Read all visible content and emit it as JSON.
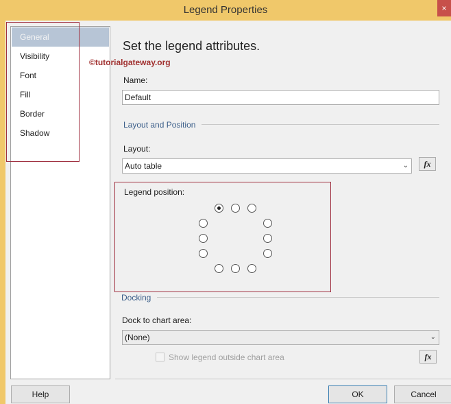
{
  "window": {
    "title": "Legend Properties",
    "close_label": "×"
  },
  "nav": {
    "items": [
      "General",
      "Visibility",
      "Font",
      "Fill",
      "Border",
      "Shadow"
    ],
    "selected": "General"
  },
  "main": {
    "heading": "Set the legend attributes.",
    "watermark": "©tutorialgateway.org",
    "name_label": "Name:",
    "name_value": "Default",
    "layout_section": "Layout and Position",
    "layout_label": "Layout:",
    "layout_value": "Auto table",
    "fx_label": "fx",
    "legend_position_label": "Legend position:",
    "legend_position_selected": "top-left",
    "docking_section": "Docking",
    "dock_label": "Dock to chart area:",
    "dock_value": "(None)",
    "show_outside_label": "Show legend outside chart area",
    "show_outside_checked": false
  },
  "footer": {
    "help": "Help",
    "ok": "OK",
    "cancel": "Cancel"
  }
}
